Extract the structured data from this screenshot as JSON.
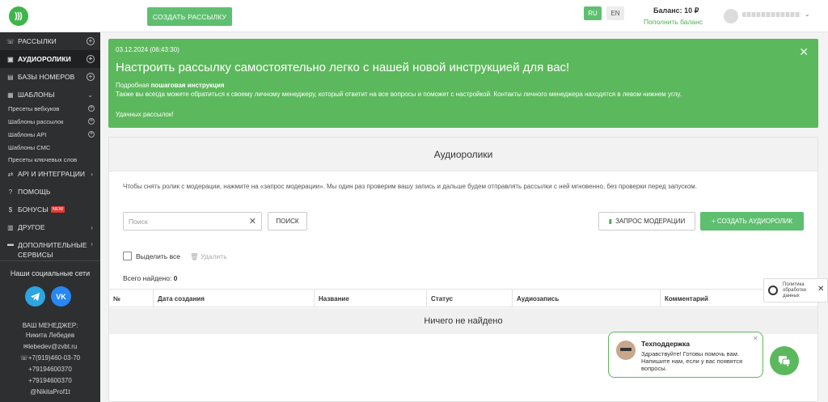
{
  "header": {
    "create_mailing": "СОЗДАТЬ РАССЫЛКУ",
    "lang_ru": "RU",
    "lang_en": "EN",
    "balance": "Баланс: 10 ₽",
    "topup": "Пополнить баланс",
    "accent": "#5fbf70"
  },
  "sidebar": {
    "items": [
      {
        "label": "РАССЫЛКИ",
        "icon": "phone-icon"
      },
      {
        "label": "АУДИОРОЛИКИ",
        "icon": "audio-icon"
      },
      {
        "label": "БАЗЫ НОМЕРОВ",
        "icon": "database-icon"
      },
      {
        "label": "ШАБЛОНЫ",
        "icon": "template-icon"
      },
      {
        "label": "API И ИНТЕГРАЦИИ",
        "icon": "api-icon"
      },
      {
        "label": "ПОМОЩЬ",
        "icon": "help-icon"
      },
      {
        "label": "БОНУСЫ",
        "icon": "gift-icon",
        "badge": "NEW"
      },
      {
        "label": "ДРУГОЕ",
        "icon": "more-icon"
      },
      {
        "label": "ДОПОЛНИТЕЛЬНЫЕ СЕРВИСЫ",
        "icon": "services-icon"
      }
    ],
    "subitems": [
      "Пресеты вебхуков",
      "Шаблоны рассылок",
      "Шаблоны API",
      "Шаблоны СМС",
      "Пресеты ключевых слов"
    ],
    "social_title": "Наши социальные сети",
    "social_tg": "telegram-icon",
    "social_vk": "VK",
    "manager": {
      "title": "ВАШ МЕНЕДЖЕР:",
      "name": "Никита Лебедев",
      "email": "lebedev@zvbt.ru",
      "phone1": "+7(919)460-03-70",
      "phone2": "+79194600370",
      "phone3": "+79194600370",
      "nick": "@NikitaProf1t"
    }
  },
  "alert": {
    "date": "03.12.2024 (06:43:30)",
    "title": "Настроить рассылку самостоятельно легко с нашей новой инструкцией для вас!",
    "line1_pre": "Подробная ",
    "line1_bold": "пошаговая инструкция",
    "line2": "Также вы всегда можете обратиться к своему личному менеджеру, который ответит на все вопросы и поможет с настройкой. Контакты личного менеджера находятся в левом нижнем углу.",
    "line3": "Удачных рассылок!"
  },
  "panel": {
    "title": "Аудиоролики",
    "description": "Чтобы снять ролик с модерации, нажмите на «запрос модерации». Мы один раз проверим вашу запись и дальше будем отправлять рассылки с ней мгновенно, без проверки перед запуском.",
    "search_placeholder": "Поиск",
    "search_button": "ПОИСК",
    "moderation_button": "ЗАПРОС МОДЕРАЦИИ",
    "create_button": "+ СОЗДАТЬ АУДИОРОЛИК",
    "select_all": "Выделить все",
    "delete": "Удалить",
    "found_label": "Всего найдено: ",
    "found_count": "0",
    "columns": [
      "№",
      "Дата создания",
      "Название",
      "Статус",
      "Аудиозапись",
      "Комментарий"
    ],
    "empty": "Ничего не найдено"
  },
  "policy": {
    "line1": "Политика",
    "line2": "обработки",
    "line3": "данных"
  },
  "support": {
    "title": "Техподдержка",
    "text": "Здравствуйте! Готовы помочь вам. Напишите нам, если у вас появятся вопросы."
  }
}
